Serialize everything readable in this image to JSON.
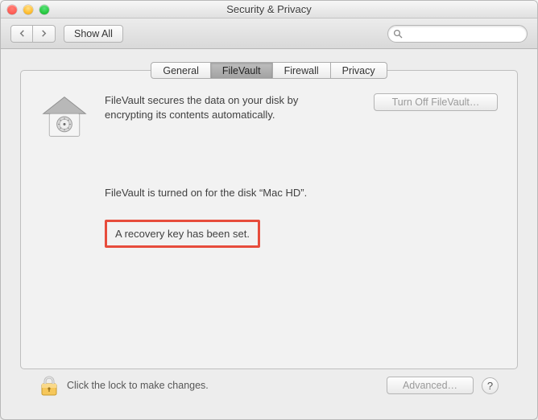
{
  "window": {
    "title": "Security & Privacy"
  },
  "toolbar": {
    "show_all_label": "Show All",
    "search_placeholder": ""
  },
  "tabs": {
    "general": "General",
    "filevault": "FileVault",
    "firewall": "Firewall",
    "privacy": "Privacy",
    "active": "filevault"
  },
  "panel": {
    "description": "FileVault secures the data on your disk by encrypting its contents automatically.",
    "turn_off_label": "Turn Off FileVault…",
    "status_line": "FileVault is turned on for the disk “Mac HD”.",
    "recovery_line": "A recovery key has been set."
  },
  "bottom": {
    "lock_text": "Click the lock to make changes.",
    "advanced_label": "Advanced…",
    "help_label": "?"
  }
}
